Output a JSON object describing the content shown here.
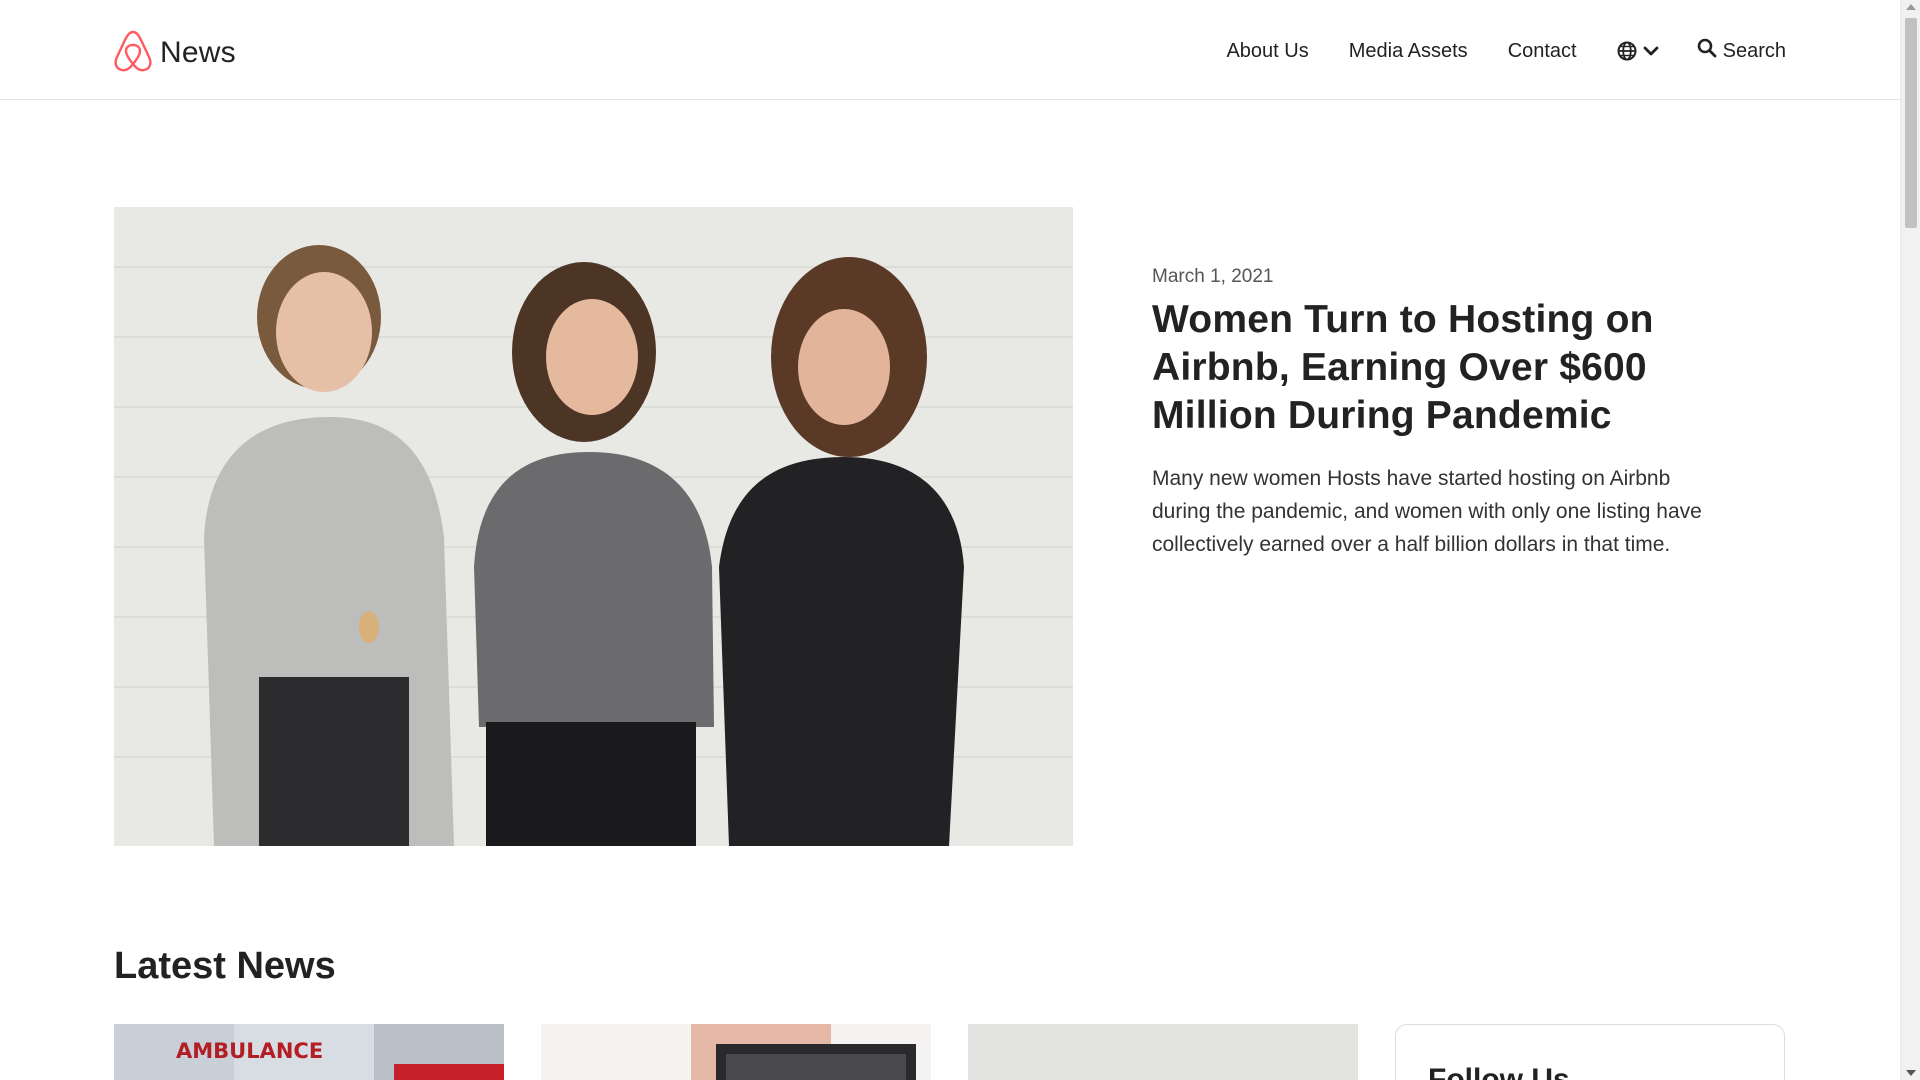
{
  "header": {
    "brand": "News",
    "brand_color": "#FF5A5F",
    "nav": {
      "about": "About Us",
      "media": "Media Assets",
      "contact": "Contact",
      "search": "Search"
    },
    "icons": [
      "airbnb-logo-icon",
      "globe-icon",
      "chevron-down-icon",
      "search-icon"
    ]
  },
  "hero": {
    "date": "March 1, 2021",
    "title": "Women Turn to Hosting on Airbnb, Earning Over $600 Million During Pandemic",
    "summary": "Many new women Hosts have started hosting on Airbnb during the pandemic, and women with only one listing have collectively earned over a half billion dollars in that time."
  },
  "latest": {
    "title": "Latest News",
    "card1_sign": "AMBULANCE",
    "follow_title": "Follow Us"
  }
}
